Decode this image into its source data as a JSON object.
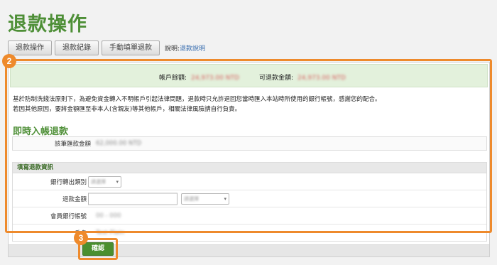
{
  "page": {
    "title": "退款操作"
  },
  "tabs": [
    {
      "label": "退款操作"
    },
    {
      "label": "退款紀錄"
    },
    {
      "label": "手動填單退款"
    }
  ],
  "description": {
    "prefix": "說明:",
    "link": "退款說明"
  },
  "balance": {
    "account_label": "帳戶餘額:",
    "account_value": "24,973.00 NTD",
    "refundable_label": "可退款金額:",
    "refundable_value": "24,973.00 NTD"
  },
  "notice": {
    "line1": "基於防制洗錢法原則下，為避免資金轉入不明帳戶引起法律問題，退款時只允許退回您當時匯入本站時所使用的銀行帳號，感謝您的配合。",
    "line2": "若因其他原因，要將金額匯至非本人(含親友)等其他帳戶，相關法律風險請自行負責。"
  },
  "instant_refund": {
    "title": "即時入帳退款",
    "amount_label": "該筆匯款金額",
    "amount_value": "62,000.00 NTD"
  },
  "form": {
    "title": "填寫退款資訊",
    "bank_category_label": "銀行轉出類別",
    "bank_category_placeholder": "請選擇",
    "refund_amount_label": "退款金額",
    "currency_placeholder": "請選擇",
    "bank_account_label": "會員銀行帳號",
    "bank_account_value": "00 - 000",
    "holder_label": "戶名",
    "holder_value": "Test Plain"
  },
  "actions": {
    "confirm_label": "確認"
  },
  "callouts": {
    "step2": "2",
    "step3": "3"
  },
  "colors": {
    "accent": "#4e8f37",
    "callout": "#ee8a2c"
  }
}
